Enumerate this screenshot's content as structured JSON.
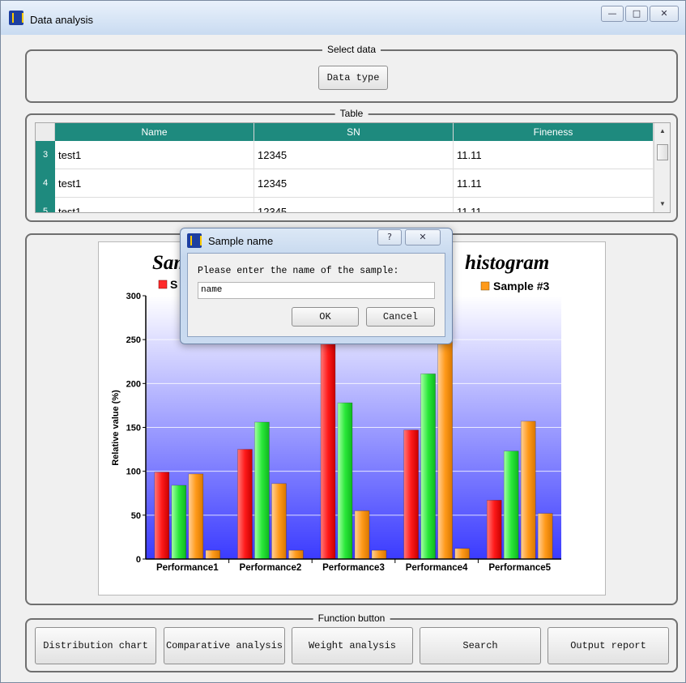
{
  "window": {
    "title": "Data analysis",
    "minimize_glyph": "—",
    "maximize_glyph": "□",
    "close_glyph": "✕"
  },
  "select_group": {
    "title": "Select data",
    "data_type_button": "Data type"
  },
  "table_group": {
    "title": "Table",
    "columns": [
      "Name",
      "SN",
      "Fineness"
    ],
    "rows": [
      {
        "num": "3",
        "name": "test1",
        "sn": "12345",
        "fineness": "11.11"
      },
      {
        "num": "4",
        "name": "test1",
        "sn": "12345",
        "fineness": "11.11"
      },
      {
        "num": "5",
        "name": "test1",
        "sn": "12345",
        "fineness": "11.11"
      }
    ],
    "header_color": "#1e8a7e"
  },
  "chart_data": {
    "type": "bar",
    "title_left": "Sam",
    "title_right": "histogram",
    "ylabel": "Relative value (%)",
    "categories": [
      "Performance1",
      "Performance2",
      "Performance3",
      "Performance4",
      "Performance5"
    ],
    "ylim": [
      0,
      300
    ],
    "yticks": [
      0,
      50,
      100,
      150,
      200,
      250,
      300
    ],
    "legend_visible": [
      {
        "label": "S",
        "color": "#ff2a2a"
      },
      {
        "label": "Sample #3",
        "color": "#ff9a1a"
      }
    ],
    "series": [
      {
        "values": [
          99,
          125,
          245,
          147,
          67
        ],
        "color": "#ff2a2a"
      },
      {
        "values": [
          84,
          156,
          178,
          211,
          123
        ],
        "color": "#22e63a"
      },
      {
        "values": [
          97,
          86,
          55,
          265,
          157
        ],
        "color": "#ff9a1a"
      },
      {
        "values": [
          10,
          10,
          10,
          12,
          52
        ],
        "color": "#ff9a1a"
      }
    ],
    "grid": true
  },
  "function_group": {
    "title": "Function button",
    "buttons": [
      "Distribution chart",
      "Comparative analysis",
      "Weight analysis",
      "Search",
      "Output report"
    ]
  },
  "dialog": {
    "title": "Sample name",
    "help_glyph": "?",
    "close_glyph": "✕",
    "prompt": "Please enter the name of the sample:",
    "input_value": "name",
    "ok_label": "OK",
    "cancel_label": "Cancel"
  }
}
